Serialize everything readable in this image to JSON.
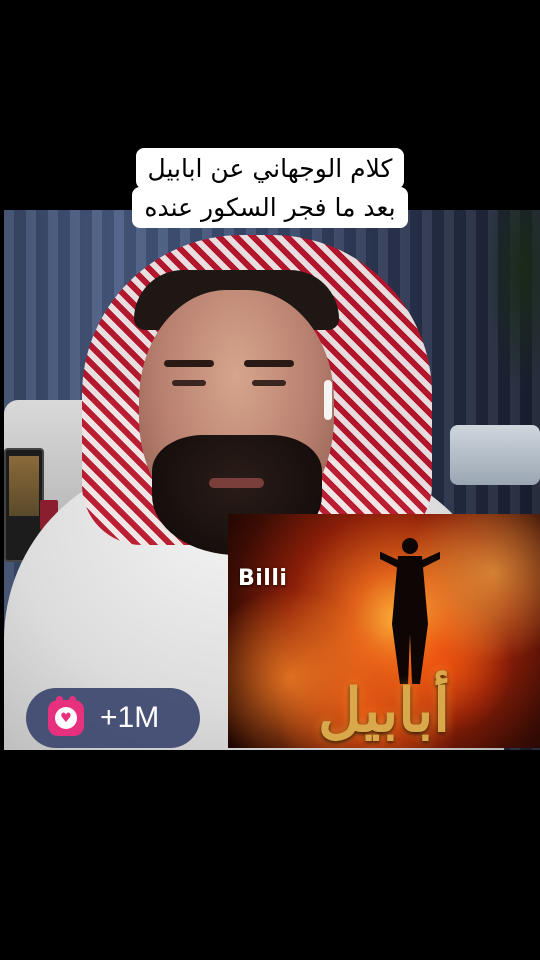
{
  "caption": {
    "line1": "كلام الوجهاني عن ابابيل",
    "line2": "بعد ما فجر السكور عنده"
  },
  "poster": {
    "brand": "Billi",
    "title": "أبابيل"
  },
  "gift_badge": {
    "icon": "gift-heart-icon",
    "count": "+1M",
    "color": "#e8317e"
  }
}
